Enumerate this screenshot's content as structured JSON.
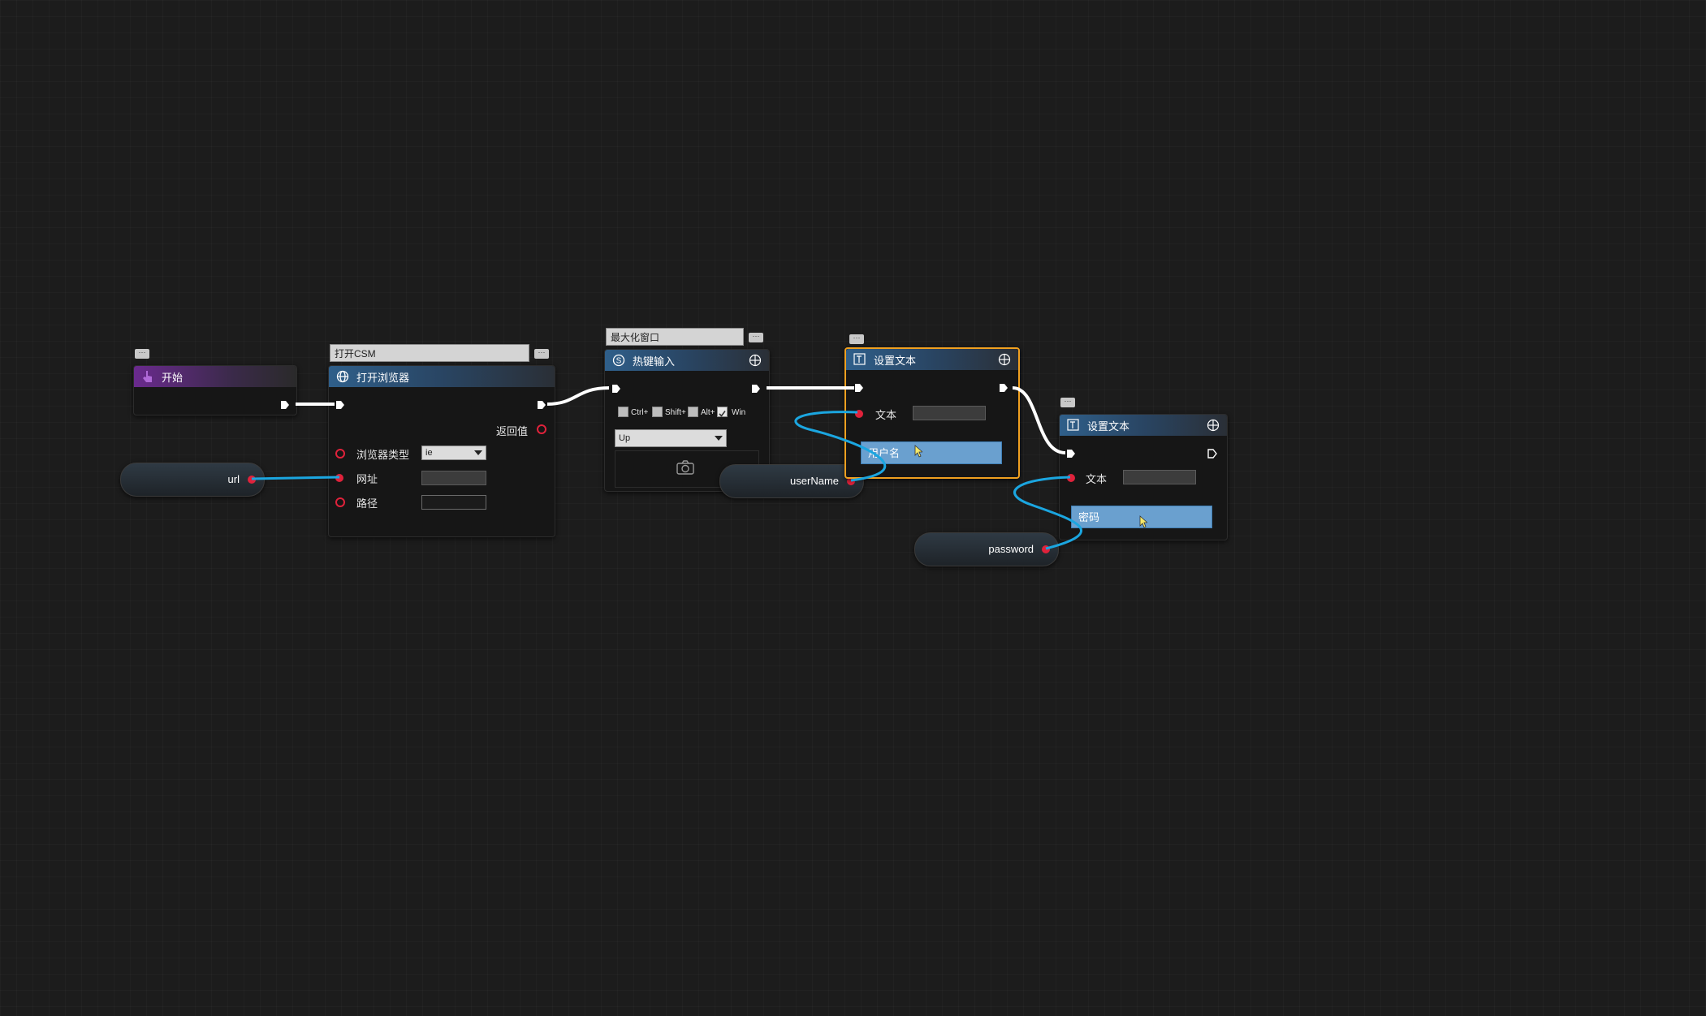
{
  "nodes": {
    "start": {
      "title": "开始"
    },
    "open_browser": {
      "comment": "打开CSM",
      "title": "打开浏览器",
      "return_label": "返回值",
      "browser_type_label": "浏览器类型",
      "browser_type_value": "ie",
      "url_label": "网址",
      "path_label": "路径"
    },
    "hotkey": {
      "comment": "最大化窗口",
      "title": "热键输入",
      "modifiers": [
        {
          "label": "Ctrl+",
          "checked": false
        },
        {
          "label": "Shift+",
          "checked": false
        },
        {
          "label": "Alt+",
          "checked": false
        },
        {
          "label": "Win",
          "checked": true
        }
      ],
      "key_value": "Up"
    },
    "set_text_1": {
      "title": "设置文本",
      "text_label": "文本",
      "target_value": "用户名"
    },
    "set_text_2": {
      "title": "设置文本",
      "text_label": "文本",
      "target_value": "密码"
    }
  },
  "variables": {
    "url": "url",
    "username": "userName",
    "password": "password"
  },
  "colors": {
    "background": "#1c1c1c",
    "exec_wire": "#ffffff",
    "data_wire": "#1ba6e0",
    "data_pin": "#e0223b",
    "selection": "#f0a020",
    "start_header": "#6a2a8e",
    "action_header": "#2f5f8a"
  }
}
